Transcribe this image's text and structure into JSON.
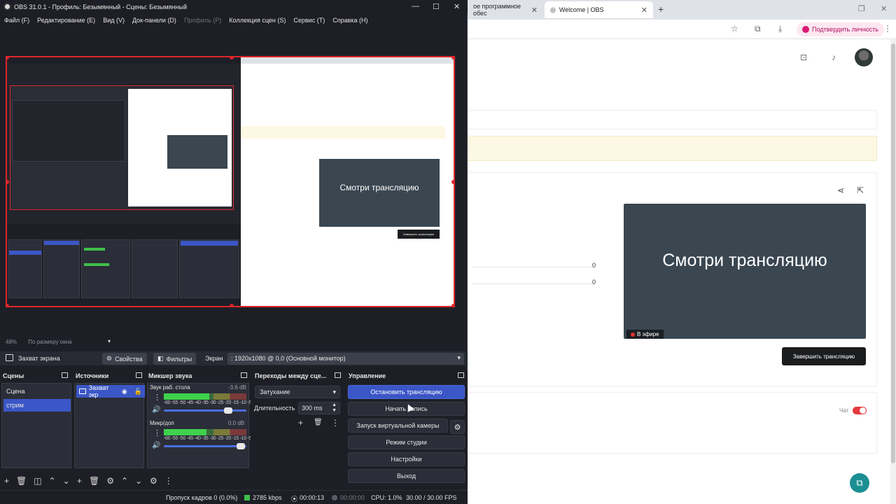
{
  "obs": {
    "title": "OBS 31.0.1 - Профиль: Безымянный - Сцены: Безымянный",
    "menu": [
      {
        "label": "Файл (F)",
        "enabled": true
      },
      {
        "label": "Редактирование (E)",
        "enabled": true
      },
      {
        "label": "Вид (V)",
        "enabled": true
      },
      {
        "label": "Док-панели (D)",
        "enabled": true
      },
      {
        "label": "Профиль (P)",
        "enabled": false
      },
      {
        "label": "Коллекция сцен (S)",
        "enabled": true
      },
      {
        "label": "Сервис (T)",
        "enabled": true
      },
      {
        "label": "Справка (H)",
        "enabled": true
      }
    ],
    "preview": {
      "nested_video_title": "Смотри трансляцию",
      "nested_end_button": "Завершить трансляцию"
    },
    "zoom": {
      "percent": "48%",
      "mode": "По размеру окна"
    },
    "source_bar": {
      "source_name": "Захват экрана",
      "properties_label": "Свойства",
      "filters_label": "Фильтры",
      "screen_label": "Экран",
      "monitor_value": ": 1920x1080 @ 0,0 (Основной монитор)"
    },
    "docks": {
      "scenes": {
        "title": "Сцены",
        "items": [
          {
            "label": "Сцена",
            "selected": false
          },
          {
            "label": "стрим",
            "selected": true
          }
        ]
      },
      "sources": {
        "title": "Источники",
        "items": [
          {
            "label": "Захват экр",
            "visible": true,
            "locked": false
          }
        ]
      },
      "mixer": {
        "title": "Микшер звука",
        "channels": [
          {
            "name": "Звук раб. стола",
            "db": "-3.6 dB",
            "level": 0.55,
            "volume": 0.78
          },
          {
            "name": "Микр/доп",
            "db": "0.0 dB",
            "level": 0.52,
            "volume": 0.93
          }
        ],
        "ticks": "-60 -55 -50 -45 -40 -35 -30 -25 -20 -15 -10 -5 0"
      },
      "transitions": {
        "title": "Переходы между сце...",
        "selected": "Затухание",
        "duration_label": "Длительность",
        "duration_value": "300 ms"
      },
      "controls": {
        "title": "Управление",
        "buttons": [
          {
            "label": "Остановить трансляцию",
            "active": true
          },
          {
            "label": "Начать запись",
            "active": false
          },
          {
            "label": "Запуск виртуальной камеры",
            "active": false
          },
          {
            "label": "Режим студии",
            "active": false
          },
          {
            "label": "Настройки",
            "active": false
          },
          {
            "label": "Выход",
            "active": false
          }
        ]
      }
    },
    "status": {
      "dropped_frames": "Пропуск кадров 0 (0.0%)",
      "bitrate": "2785 kbps",
      "stream_time": "00:00:13",
      "record_time": "00:00:00",
      "cpu": "CPU: 1.0%",
      "fps": "30.00 / 30.00 FPS"
    }
  },
  "browser": {
    "tabs": [
      {
        "label": "ое программное обес",
        "active": false
      },
      {
        "label": "Welcome | OBS",
        "active": true
      }
    ],
    "profile_button": "Подтвердить личность",
    "stream_card": {
      "video_title": "Смотри трансляцию",
      "live_badge": "В эфире",
      "end_button": "Завершить трансляцию",
      "stats": [
        "0",
        "0"
      ]
    },
    "chat_label": "Чат",
    "chat_enabled": true
  }
}
